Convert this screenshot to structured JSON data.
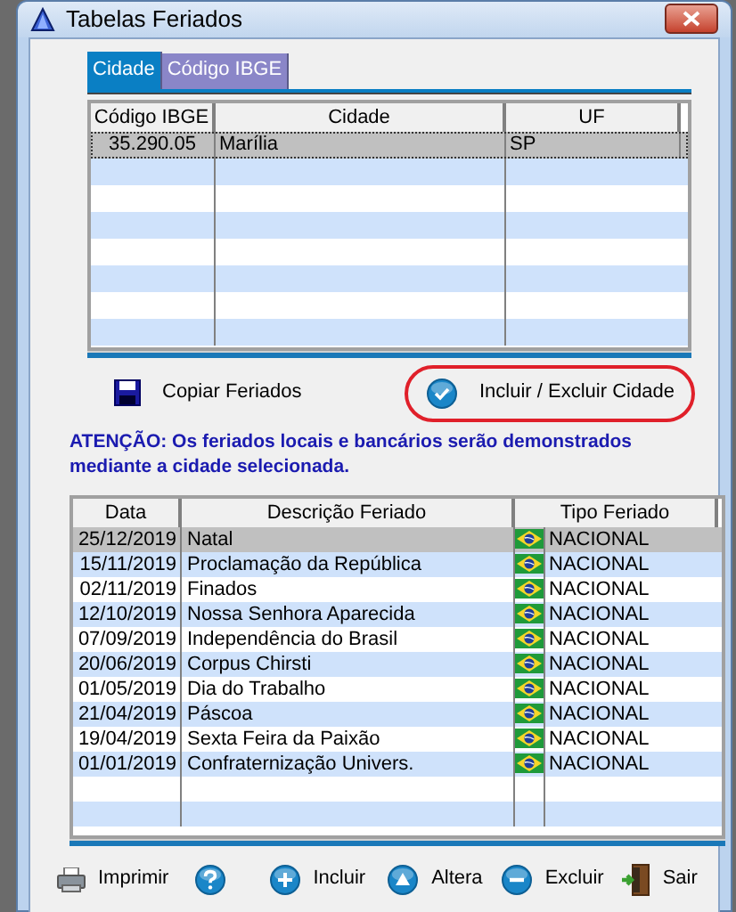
{
  "window": {
    "title": "Tabelas Feriados"
  },
  "tabs": [
    {
      "label": "Cidade",
      "selected": true
    },
    {
      "label": "Código IBGE",
      "selected": false
    }
  ],
  "cities_table": {
    "columns": [
      "Código IBGE",
      "Cidade",
      "UF"
    ],
    "rows": [
      {
        "cells": [
          "35.290.05",
          "Marília",
          "SP"
        ],
        "selected": true
      }
    ]
  },
  "actions": [
    {
      "label": "Copiar Feriados",
      "kind": "save",
      "highlighted": false
    },
    {
      "label": "Incluir / Excluir Cidade",
      "kind": "check",
      "highlighted": true
    }
  ],
  "notice": "ATENÇÃO: Os feriados locais e bancários serão demonstrados mediante a cidade selecionada.",
  "holidays_table": {
    "columns": [
      "Data",
      "Descrição Feriado",
      "Tipo Feriado"
    ],
    "rows": [
      {
        "date": "25/12/2019",
        "description": "Natal",
        "type": "NACIONAL",
        "selected": true
      },
      {
        "date": "15/11/2019",
        "description": "Proclamação da República",
        "type": "NACIONAL",
        "selected": false
      },
      {
        "date": "02/11/2019",
        "description": "Finados",
        "type": "NACIONAL",
        "selected": false
      },
      {
        "date": "12/10/2019",
        "description": "Nossa Senhora Aparecida",
        "type": "NACIONAL",
        "selected": false
      },
      {
        "date": "07/09/2019",
        "description": "Independência do Brasil",
        "type": "NACIONAL",
        "selected": false
      },
      {
        "date": "20/06/2019",
        "description": "Corpus Chirsti",
        "type": "NACIONAL",
        "selected": false
      },
      {
        "date": "01/05/2019",
        "description": "Dia do Trabalho",
        "type": "NACIONAL",
        "selected": false
      },
      {
        "date": "21/04/2019",
        "description": "Páscoa",
        "type": "NACIONAL",
        "selected": false
      },
      {
        "date": "19/04/2019",
        "description": "Sexta Feira da Paixão",
        "type": "NACIONAL",
        "selected": false
      },
      {
        "date": "01/01/2019",
        "description": "Confraternização Univers.",
        "type": "NACIONAL",
        "selected": false
      }
    ]
  },
  "toolbar": [
    {
      "kind": "print",
      "label": "Imprimir"
    },
    {
      "kind": "help"
    },
    {
      "kind": "plus",
      "label": "Incluir"
    },
    {
      "kind": "up",
      "label": "Altera"
    },
    {
      "kind": "minus",
      "label": "Excluir"
    },
    {
      "kind": "exit",
      "label": "Sair"
    }
  ]
}
